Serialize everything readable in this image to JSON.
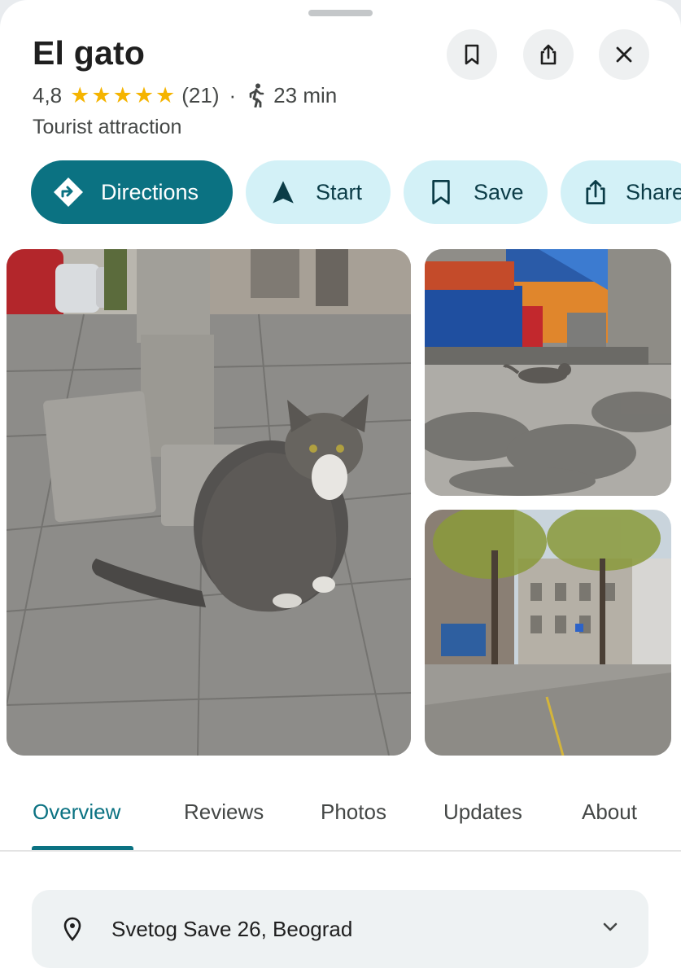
{
  "place": {
    "title": "El gato",
    "rating": "4,8",
    "stars": 4.8,
    "review_count": "(21)",
    "separator": "·",
    "walk_time": "23 min",
    "category": "Tourist attraction"
  },
  "header_buttons": [
    {
      "name": "save-bookmark",
      "icon": "bookmark-icon"
    },
    {
      "name": "share",
      "icon": "share-icon"
    },
    {
      "name": "close",
      "icon": "close-icon"
    }
  ],
  "actions": {
    "directions": "Directions",
    "start": "Start",
    "save": "Save",
    "share": "Share"
  },
  "photos": [
    {
      "subject": "tabby cat sitting on sidewalk"
    },
    {
      "subject": "cat walking past a kiosk"
    },
    {
      "subject": "street with trees"
    }
  ],
  "tabs": [
    "Overview",
    "Reviews",
    "Photos",
    "Updates",
    "About"
  ],
  "active_tab": "Overview",
  "address": {
    "text": "Svetog Save 26, Beograd",
    "icon": "location-pin-icon"
  },
  "colors": {
    "accent": "#0b7282",
    "chip_bg": "#d3f1f7",
    "star": "#f5b400"
  }
}
